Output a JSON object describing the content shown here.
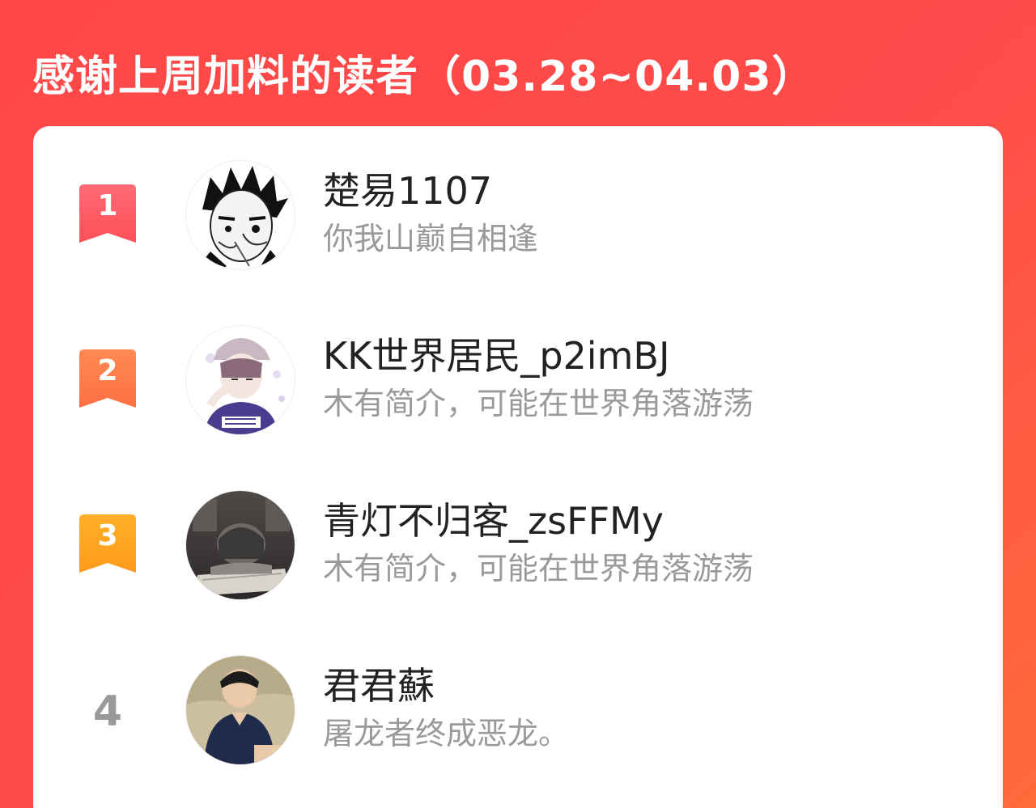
{
  "header": {
    "title": "感谢上周加料的读者（03.28~04.03）"
  },
  "colors": {
    "background": "#ff4b4b",
    "rank1": "#ff5a63",
    "rank2": "#ff7a4a",
    "rank3": "#ffa41f",
    "rank_plain": "#999999"
  },
  "readers": [
    {
      "rank": "1",
      "name": "楚易1107",
      "bio": "你我山巅自相逢",
      "avatar": "manga-character-avatar"
    },
    {
      "rank": "2",
      "name": "KK世界居民_p2imBJ",
      "bio": "木有简介，可能在世界角落游荡",
      "avatar": "anime-boy-cap-avatar"
    },
    {
      "rank": "3",
      "name": "青灯不归客_zsFFMy",
      "bio": "木有简介，可能在世界角落游荡",
      "avatar": "sleeping-girl-avatar"
    },
    {
      "rank": "4",
      "name": "君君蘇",
      "bio": "屠龙者终成恶龙。",
      "avatar": "person-photo-avatar"
    }
  ]
}
